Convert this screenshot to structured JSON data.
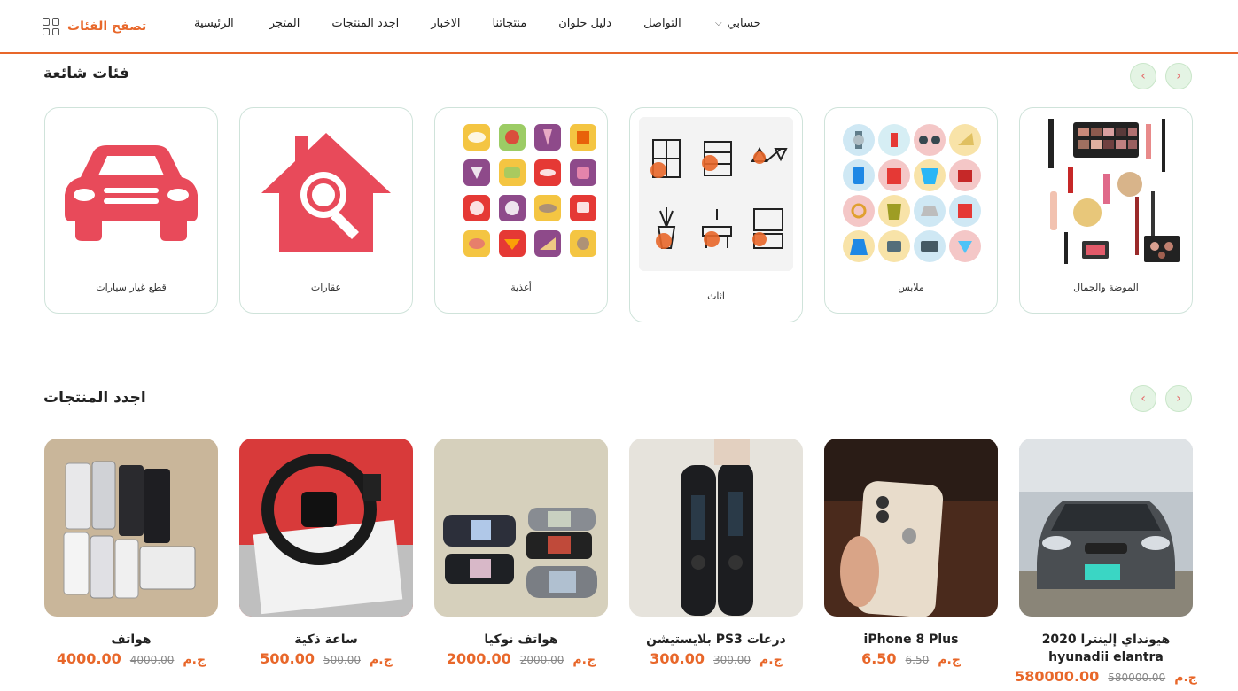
{
  "header": {
    "browse_label": "تصفح الفئات",
    "nav": [
      "الرئيسية",
      "المتجر",
      "اجدد المنتجات",
      "الاخبار",
      "منتجاتنا",
      "دليل حلوان",
      "التواصل"
    ],
    "account_label": "حسابي"
  },
  "categories_section": {
    "title": "فئات شائعة",
    "items": [
      {
        "label": "الموضة والجمال"
      },
      {
        "label": "ملابس"
      },
      {
        "label": "اثاث"
      },
      {
        "label": "أغذية"
      },
      {
        "label": "عقارات"
      },
      {
        "label": "قطع غيار سيارات"
      }
    ]
  },
  "products_section": {
    "title": "اجدد المنتجات",
    "currency": "ج.م",
    "items": [
      {
        "title": "هيونداي إلينترا 2020 hyunadii elantra",
        "price": "580000.00",
        "old_price": "580000.00"
      },
      {
        "title": "iPhone 8 Plus",
        "price": "6.50",
        "old_price": "6.50"
      },
      {
        "title": "بلايستيشن PS3 درعات",
        "price": "300.00",
        "old_price": "300.00"
      },
      {
        "title": "هواتف نوكيا",
        "price": "2000.00",
        "old_price": "2000.00"
      },
      {
        "title": "ساعة ذكية",
        "price": "500.00",
        "old_price": "500.00"
      },
      {
        "title": "هواتف",
        "price": "4000.00",
        "old_price": "4000.00"
      }
    ]
  },
  "colors": {
    "accent": "#e8672a",
    "category_red": "#e84a5a"
  }
}
